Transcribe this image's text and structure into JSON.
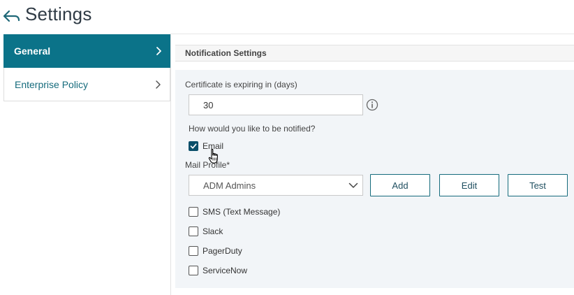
{
  "header": {
    "title": "Settings",
    "back_icon": "back-arrow-icon"
  },
  "sidebar": {
    "items": [
      {
        "label": "General",
        "active": true,
        "icon": "chevron-right-icon"
      },
      {
        "label": "Enterprise Policy",
        "active": false,
        "icon": "chevron-right-icon"
      }
    ]
  },
  "notification": {
    "section_title": "Notification Settings",
    "expiry_label": "Certificate is expiring in (days)",
    "expiry_value": "30",
    "info_icon": "info-icon",
    "notify_question": "How would you like to be notified?",
    "email": {
      "label": "Email",
      "checked": true
    },
    "mail_profile_label": "Mail Profile*",
    "mail_profile_value": "ADM Admins",
    "buttons": {
      "add": "Add",
      "edit": "Edit",
      "test": "Test"
    },
    "channels": [
      {
        "label": "SMS (Text Message)",
        "checked": false
      },
      {
        "label": "Slack",
        "checked": false
      },
      {
        "label": "PagerDuty",
        "checked": false
      },
      {
        "label": "ServiceNow",
        "checked": false
      }
    ]
  },
  "colors": {
    "accent": "#0b7389",
    "checkbox_checked": "#0b4f6a",
    "panel_background": "#f2f5f8",
    "link_text": "#156b7c"
  },
  "cursor": "hand-pointer-icon"
}
